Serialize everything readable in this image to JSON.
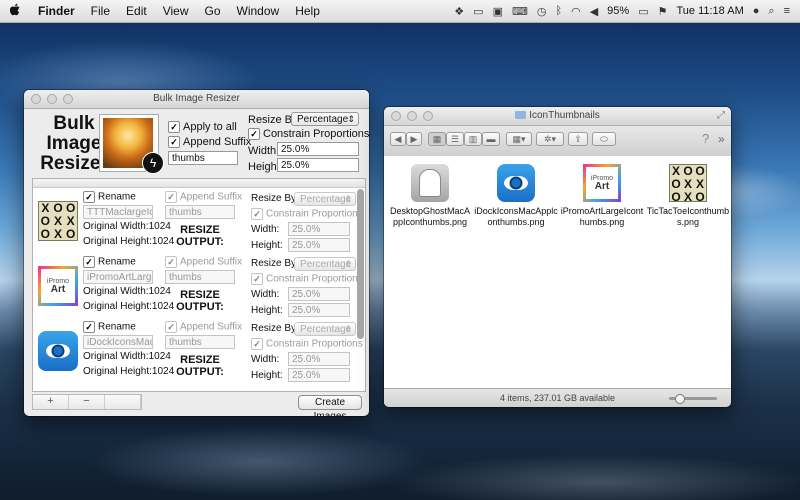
{
  "menubar": {
    "apple": "",
    "app_name": "Finder",
    "items": [
      "File",
      "Edit",
      "View",
      "Go",
      "Window",
      "Help"
    ],
    "battery": "95%",
    "clock": "Tue 11:18 AM"
  },
  "bulk": {
    "title": "Bulk Image Resizer",
    "logo": "Bulk Image Resizer",
    "apply_to_all": "Apply to all",
    "append_suffix": "Append Suffix",
    "suffix_value": "thumbs",
    "resize_by_label": "Resize By:",
    "resize_by_value": "Percentage",
    "constrain": "Constrain Proportions",
    "width_label": "Width:",
    "width_value": "25.0%",
    "height_label": "Height:",
    "height_value": "25.0%",
    "items": [
      {
        "rename": "Rename",
        "rename_value": "TTTMaclargeIcon",
        "append_suffix": "Append Suffix",
        "suffix_value": "thumbs",
        "original_width": "Original Width:1024",
        "original_height": "Original Height:1024",
        "resize_output": "RESIZE OUTPUT:",
        "resize_by_label": "Resize By:",
        "resize_by_value": "Percentage",
        "constrain": "Constrain Proportions",
        "width_label": "Width:",
        "width_value": "25.0%",
        "height_label": "Height:",
        "height_value": "25.0%"
      },
      {
        "rename": "Rename",
        "rename_value": "iPromoArtLargeIc",
        "append_suffix": "Append Suffix",
        "suffix_value": "thumbs",
        "original_width": "Original Width:1024",
        "original_height": "Original Height:1024",
        "resize_output": "RESIZE OUTPUT:",
        "resize_by_label": "Resize By:",
        "resize_by_value": "Percentage",
        "constrain": "Constrain Proportions",
        "width_label": "Width:",
        "width_value": "25.0%",
        "height_label": "Height:",
        "height_value": "25.0%"
      },
      {
        "rename": "Rename",
        "rename_value": "iDockIconsMacAp",
        "append_suffix": "Append Suffix",
        "suffix_value": "thumbs",
        "original_width": "Original Width:1024",
        "original_height": "Original Height:1024",
        "resize_output": "RESIZE OUTPUT:",
        "resize_by_label": "Resize By:",
        "resize_by_value": "Percentage",
        "constrain": "Constrain Proportions",
        "width_label": "Width:",
        "width_value": "25.0%",
        "height_label": "Height:",
        "height_value": "25.0%"
      }
    ],
    "add_label": "+",
    "remove_label": "−",
    "create_button": "Create Images"
  },
  "finder": {
    "title": "IconThumbnails",
    "files": [
      {
        "name": "DesktopGhostMacAppIconthumbs.png",
        "icon": "ghost-icon"
      },
      {
        "name": "iDockIconsMacApplconthumbs.png",
        "icon": "eye-icon"
      },
      {
        "name": "iPromoArtLargeIconthumbs.png",
        "icon": "ipromo-art-icon"
      },
      {
        "name": "TicTacToeIconthumbs.png",
        "icon": "tic-tac-toe-icon"
      }
    ],
    "status": "4 items, 237.01 GB available",
    "ipromo_lines": [
      "iPromo",
      "Art"
    ]
  },
  "tictactoe": [
    "X",
    "O",
    "O",
    "O",
    "X",
    "X",
    "O",
    "X",
    "O"
  ]
}
